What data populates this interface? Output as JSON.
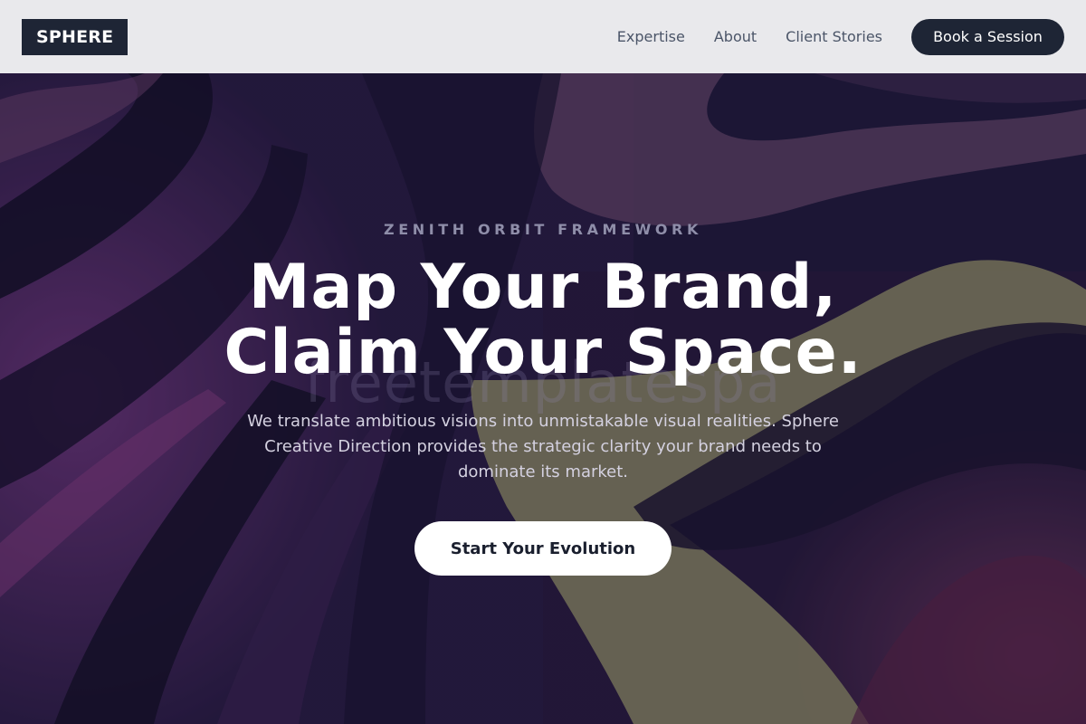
{
  "brand": {
    "logo_text": "SPHERE"
  },
  "nav": {
    "links": [
      "Expertise",
      "About",
      "Client Stories"
    ],
    "cta_label": "Book a Session"
  },
  "hero": {
    "eyebrow": "ZENITH ORBIT FRAMEWORK",
    "headline_line1": "Map Your Brand,",
    "headline_line2": "Claim Your Space.",
    "watermark": "freetemplatespa",
    "subtext": "We translate ambitious visions into unmistakable visual realities. Sphere Creative Direction provides the strategic clarity your brand needs to dominate its market.",
    "cta_label": "Start Your Evolution"
  },
  "colors": {
    "navbar_bg": "#e9e9ec",
    "dark_navy": "#1e2535",
    "hero_purple": "#6a2f72",
    "hero_deep": "#1b1734",
    "hero_olive": "#8e8a67"
  }
}
